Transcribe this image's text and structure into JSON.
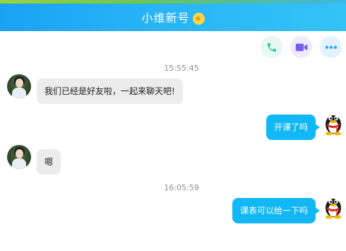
{
  "header": {
    "title": "小维新号",
    "badge_icon": "star-icon",
    "colors": {
      "gradient_start": "#1aa2f4",
      "gradient_end": "#33c3f7"
    }
  },
  "actions": [
    {
      "name": "call-button",
      "icon": "phone-icon",
      "color": "#27c29a"
    },
    {
      "name": "video-button",
      "icon": "video-camera-icon",
      "color": "#7b5ce8"
    },
    {
      "name": "more-button",
      "icon": "more-dots-icon",
      "color": "#2ba8f2"
    }
  ],
  "messages": {
    "ts1": "15:55:45",
    "m1": "我们已经是好友啦，一起来聊天吧!",
    "m2": "开课了吗",
    "m3": "嗯",
    "ts2": "16:05:59",
    "m4": "课表可以给一下吗"
  },
  "colors": {
    "incoming_bubble": "#ececec",
    "outgoing_bubble": "#12b7f5",
    "timestamp_text": "#8c8c8c"
  }
}
